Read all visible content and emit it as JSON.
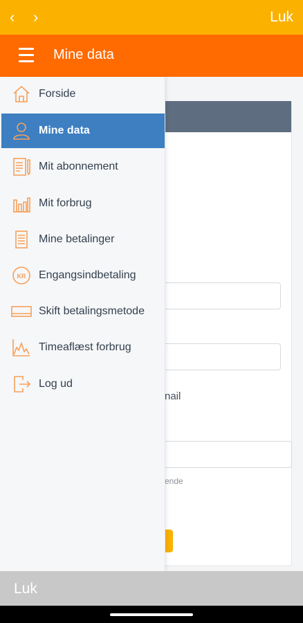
{
  "topbar": {
    "back_icon": "‹",
    "forward_icon": "›",
    "close_label": "Luk"
  },
  "header": {
    "title": "Mine data"
  },
  "background": {
    "email_fragment": "nail",
    "hint_fragment": "ende"
  },
  "drawer": {
    "items": [
      {
        "label": "Forside",
        "icon": "home-icon",
        "active": false
      },
      {
        "label": "Mine data",
        "icon": "user-icon",
        "active": true
      },
      {
        "label": "Mit abonnement",
        "icon": "document-pen-icon",
        "active": false
      },
      {
        "label": "Mit forbrug",
        "icon": "bar-chart-icon",
        "active": false
      },
      {
        "label": "Mine betalinger",
        "icon": "receipt-icon",
        "active": false
      },
      {
        "label": "Engangsindbetaling",
        "icon": "kr-coin-icon",
        "active": false
      },
      {
        "label": "Skift betalingsmetode",
        "icon": "card-icon",
        "active": false
      },
      {
        "label": "Timeaflæst forbrug",
        "icon": "line-chart-icon",
        "active": false
      },
      {
        "label": "Log ud",
        "icon": "logout-icon",
        "active": false
      }
    ]
  },
  "bottombar": {
    "close_label": "Luk"
  },
  "colors": {
    "topbar": "#fbb100",
    "header": "#ff6b00",
    "active": "#3d7fc1",
    "icon": "#f5a05a"
  }
}
